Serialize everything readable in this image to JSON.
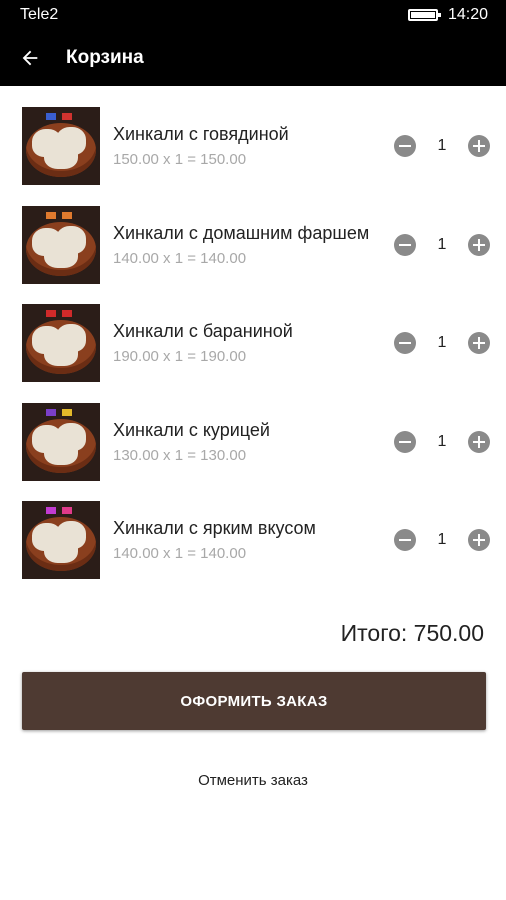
{
  "status_bar": {
    "carrier": "Tele2",
    "time": "14:20"
  },
  "app_bar": {
    "title": "Корзина",
    "back_icon": "arrow-back-icon"
  },
  "cart": {
    "items": [
      {
        "name": "Хинкали с говядиной",
        "calc": "150.00 x 1 = 150.00",
        "quantity": "1",
        "flag_colors": [
          "#3a5fd0",
          "#d0332f"
        ]
      },
      {
        "name": "Хинкали с домашним фаршем",
        "calc": "140.00 x 1 = 140.00",
        "quantity": "1",
        "flag_colors": [
          "#e07a2e",
          "#e07a2e"
        ]
      },
      {
        "name": "Хинкали с бараниной",
        "calc": "190.00 x 1 = 190.00",
        "quantity": "1",
        "flag_colors": [
          "#d02a2a",
          "#d02a2a"
        ]
      },
      {
        "name": "Хинкали с курицей",
        "calc": "130.00 x 1 = 130.00",
        "quantity": "1",
        "flag_colors": [
          "#7b3fc8",
          "#e3b92a"
        ]
      },
      {
        "name": "Хинкали с ярким вкусом",
        "calc": "140.00 x 1 = 140.00",
        "quantity": "1",
        "flag_colors": [
          "#c23bd0",
          "#e03a8a"
        ]
      }
    ]
  },
  "summary": {
    "total": "Итого: 750.00"
  },
  "actions": {
    "checkout_label": "ОФОРМИТЬ ЗАКАЗ",
    "cancel_label": "Отменить заказ"
  },
  "colors": {
    "checkout_bg": "#4e3a32",
    "bar_bg": "#000000",
    "qty_button": "#8a8a8a"
  }
}
